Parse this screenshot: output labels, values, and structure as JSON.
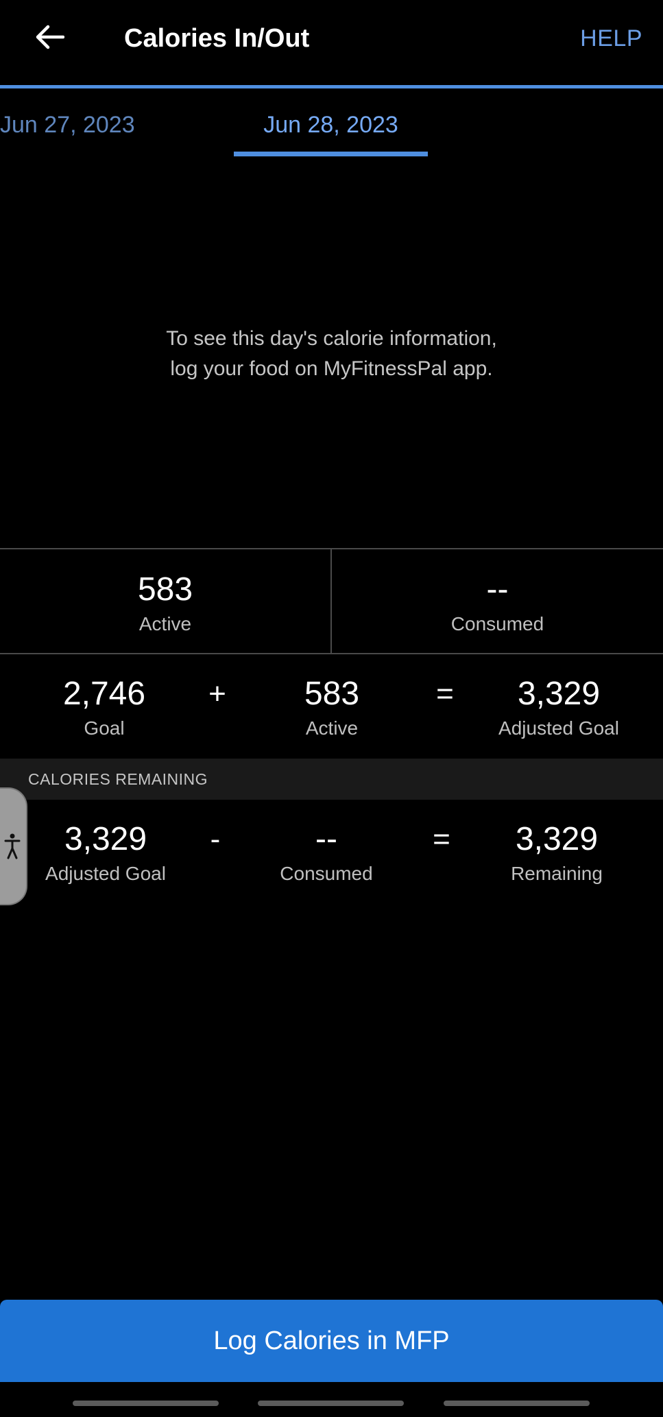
{
  "header": {
    "title": "Calories In/Out",
    "help_label": "HELP",
    "back_icon": "arrow-left-icon"
  },
  "tabs": {
    "previous_date": "Jun 27, 2023",
    "current_date": "Jun 28, 2023"
  },
  "empty_message": {
    "line1": "To see this day's calorie information,",
    "line2": "log your food on MyFitnessPal app."
  },
  "summary": {
    "active_value": "583",
    "active_label": "Active",
    "consumed_value": "--",
    "consumed_label": "Consumed"
  },
  "goal_equation": {
    "goal_value": "2,746",
    "goal_label": "Goal",
    "plus": "+",
    "active_value": "583",
    "active_label": "Active",
    "equals": "=",
    "adjusted_value": "3,329",
    "adjusted_label": "Adjusted Goal"
  },
  "remaining_section": {
    "label": "CALORIES REMAINING",
    "adjusted_value": "3,329",
    "adjusted_label": "Adjusted Goal",
    "minus": "-",
    "consumed_value": "--",
    "consumed_label": "Consumed",
    "equals": "=",
    "remaining_value": "3,329",
    "remaining_label": "Remaining"
  },
  "accessibility": {
    "icon": "accessibility-icon"
  },
  "log_button": {
    "label": "Log Calories in MFP"
  },
  "colors": {
    "accent": "#4f8fe0",
    "help_text": "#6c9ee6",
    "button_bg": "#1f74d4",
    "background": "#000000"
  }
}
